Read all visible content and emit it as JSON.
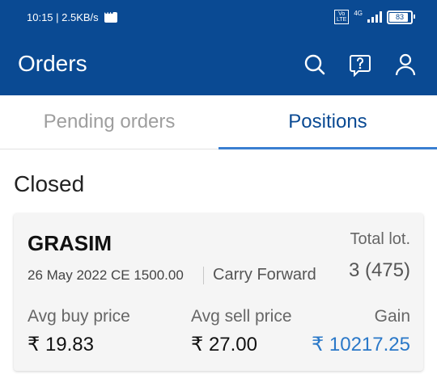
{
  "status_bar": {
    "time_speed": "10:15 | 2.5KB/s",
    "network": "4G",
    "volte": "Vo LTE",
    "battery": "83"
  },
  "app_bar": {
    "title": "Orders",
    "icons": [
      "search-icon",
      "help-icon",
      "profile-icon"
    ]
  },
  "tabs": [
    {
      "label": "Pending orders",
      "active": false
    },
    {
      "label": "Positions",
      "active": true
    }
  ],
  "section": {
    "title": "Closed"
  },
  "position_card": {
    "symbol": "GRASIM",
    "contract": "26 May 2022 CE 1500.00",
    "product": "Carry Forward",
    "total_lot_label": "Total lot.",
    "total_lot_value": "3 (475)",
    "avg_buy_label": "Avg buy price",
    "avg_buy_value": "₹ 19.83",
    "avg_sell_label": "Avg sell price",
    "avg_sell_value": "₹ 27.00",
    "gain_label": "Gain",
    "gain_value": "₹ 10217.25"
  },
  "colors": {
    "brand": "#0a4a93",
    "accent": "#3a7fd1",
    "gain": "#2a78c8"
  }
}
